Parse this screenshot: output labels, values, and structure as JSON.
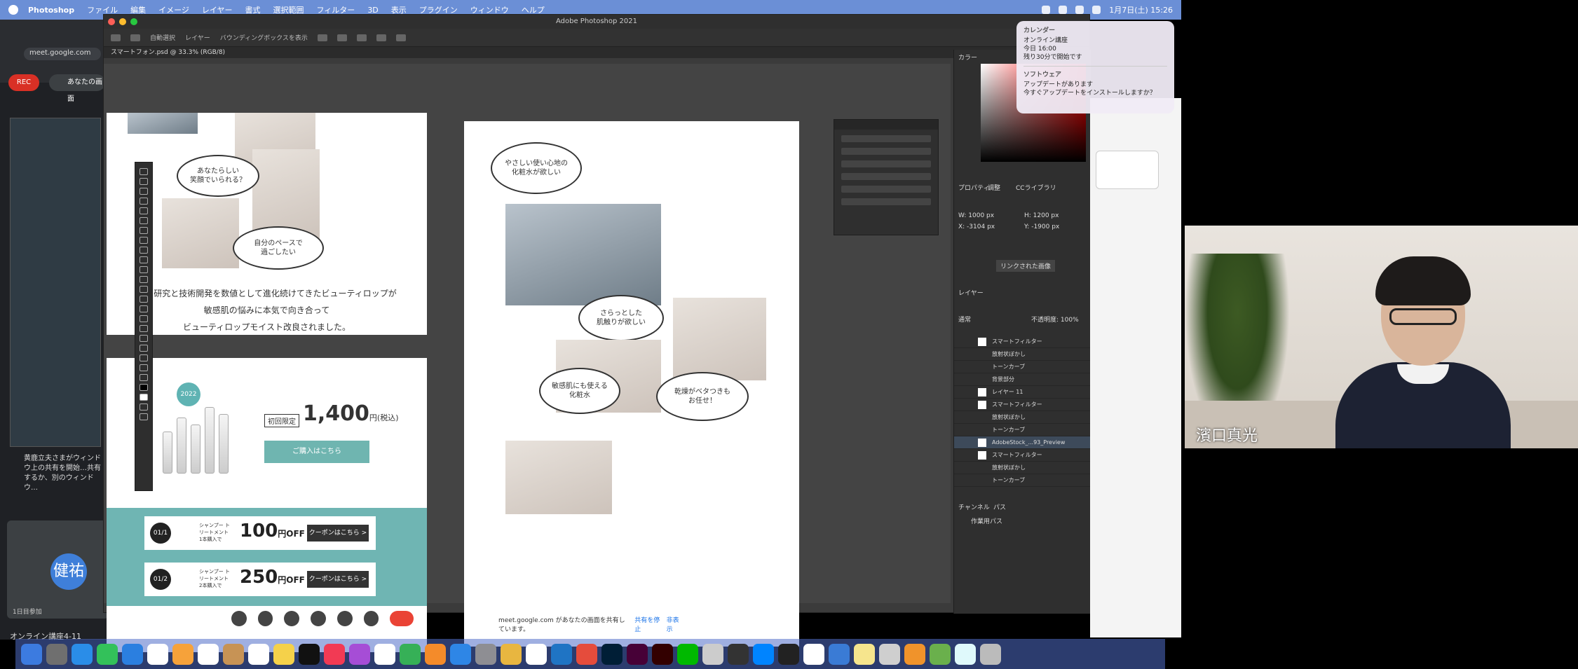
{
  "menubar": {
    "app": "Photoshop",
    "items": [
      "ファイル",
      "編集",
      "イメージ",
      "レイヤー",
      "書式",
      "選択範囲",
      "フィルター",
      "3D",
      "表示",
      "プラグイン",
      "ウィンドウ",
      "ヘルプ"
    ],
    "clock": "1月7日(土) 15:26"
  },
  "meet": {
    "url": "meet.google.com",
    "rec_label": "REC",
    "share_label": "あなたの画面",
    "chat_note": "黄鹿立夫さまがウィンドウ上の共有を開始…共有するか、別のウィンドウ…",
    "avatar": "健祐",
    "tile_name": "1日目参加",
    "meeting_title": "オンライン講座4-11"
  },
  "photoshop": {
    "window_title": "Adobe Photoshop 2021",
    "doc_tab": "スマートフォン.psd @ 33.3% (RGB/8)",
    "option_labels": [
      "自動選択",
      "レイヤー",
      "バウンディングボックスを表示"
    ],
    "art1": {
      "bubble1": "あなたらしい\n笑顔でいられる？",
      "bubble2": "自分のペースで\n過ごしたい",
      "copy_lines": [
        "人と研究と技術開発を数値として進化続けてきたビューティロップが",
        "敏感肌の悩みに本気で向き合って",
        "ビューティロップモイスト改良されました。"
      ]
    },
    "art2": {
      "badge": "2022",
      "price_label": "初回限定",
      "price": "1,400",
      "price_unit": "円(税込)",
      "buy_button": "ご購入はこちら",
      "coupons": [
        {
          "no": "01/1",
          "desc": "シャンプー トリートメント 1本購入で",
          "amount": "100",
          "unit": "円OFF",
          "button": "クーポンはこちら >"
        },
        {
          "no": "01/2",
          "desc": "シャンプー トリートメント 2本購入で",
          "amount": "250",
          "unit": "円OFF",
          "button": "クーポンはこちら >"
        }
      ]
    },
    "art3": {
      "bubble_top": "やさしい使い心地の\n化粧水が欲しい",
      "bubble_mid": "さらっとした\n肌触りが欲しい",
      "bubble_left": "敏感肌にも使える\n化粧水",
      "bubble_right": "乾燥がベタつきも\nお任せ！"
    },
    "panels": {
      "color_tab": "カラー",
      "properties_tab": "プロパティ",
      "adjust_tab": "調整",
      "libs_tab": "CCライブラリ",
      "w_value": "W: 1000 px",
      "h_value": "H: 1200 px",
      "x_value": "X: -3104 px",
      "y_value": "Y: -1900 px",
      "layers_tab": "レイヤー",
      "layer_mode": "通常",
      "opacity": "不透明度: 100%",
      "layers": [
        "スマートフィルター",
        "放射状ぼかし",
        "トーンカーブ",
        "背景部分",
        "レイヤー 11",
        "スマートフィルター",
        "放射状ぼかし",
        "トーンカーブ",
        "AdobeStock_...93_Preview",
        "スマートフィルター",
        "放射状ぼかし",
        "トーンカーブ"
      ],
      "channels_tab": "チャンネル",
      "paths_tab": "パス",
      "path_item": "作業用パス",
      "embed_button": "リンクされた画像"
    }
  },
  "notifications": {
    "n1_app": "カレンダー",
    "n1_title": "オンライン講座",
    "n1_time": "今日 16:00",
    "n1_body": "残り30分で開始です",
    "n2_app": "ソフトウェア",
    "n2_title": "アップデートがあります",
    "n2_body": "今すぐアップデートをインストールしますか？"
  },
  "sharebar": {
    "text": "meet.google.com があなたの画面を共有しています。",
    "stop": "共有を停止",
    "hide": "非表示"
  },
  "webcam": {
    "name": "濱口真光"
  },
  "colors": {
    "menubar": "#6b8fd6",
    "teal": "#6fb5b3",
    "end_call": "#ea4335"
  }
}
